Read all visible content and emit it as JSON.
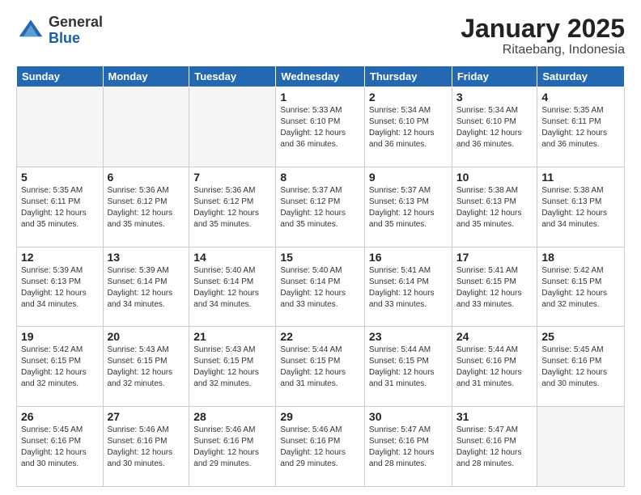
{
  "logo": {
    "general": "General",
    "blue": "Blue"
  },
  "header": {
    "month": "January 2025",
    "location": "Ritaebang, Indonesia"
  },
  "weekdays": [
    "Sunday",
    "Monday",
    "Tuesday",
    "Wednesday",
    "Thursday",
    "Friday",
    "Saturday"
  ],
  "rows": [
    [
      {
        "day": "",
        "sunrise": "",
        "sunset": "",
        "daylight": "",
        "empty": true
      },
      {
        "day": "",
        "sunrise": "",
        "sunset": "",
        "daylight": "",
        "empty": true
      },
      {
        "day": "",
        "sunrise": "",
        "sunset": "",
        "daylight": "",
        "empty": true
      },
      {
        "day": "1",
        "sunrise": "Sunrise: 5:33 AM",
        "sunset": "Sunset: 6:10 PM",
        "daylight": "Daylight: 12 hours and 36 minutes."
      },
      {
        "day": "2",
        "sunrise": "Sunrise: 5:34 AM",
        "sunset": "Sunset: 6:10 PM",
        "daylight": "Daylight: 12 hours and 36 minutes."
      },
      {
        "day": "3",
        "sunrise": "Sunrise: 5:34 AM",
        "sunset": "Sunset: 6:10 PM",
        "daylight": "Daylight: 12 hours and 36 minutes."
      },
      {
        "day": "4",
        "sunrise": "Sunrise: 5:35 AM",
        "sunset": "Sunset: 6:11 PM",
        "daylight": "Daylight: 12 hours and 36 minutes."
      }
    ],
    [
      {
        "day": "5",
        "sunrise": "Sunrise: 5:35 AM",
        "sunset": "Sunset: 6:11 PM",
        "daylight": "Daylight: 12 hours and 35 minutes."
      },
      {
        "day": "6",
        "sunrise": "Sunrise: 5:36 AM",
        "sunset": "Sunset: 6:12 PM",
        "daylight": "Daylight: 12 hours and 35 minutes."
      },
      {
        "day": "7",
        "sunrise": "Sunrise: 5:36 AM",
        "sunset": "Sunset: 6:12 PM",
        "daylight": "Daylight: 12 hours and 35 minutes."
      },
      {
        "day": "8",
        "sunrise": "Sunrise: 5:37 AM",
        "sunset": "Sunset: 6:12 PM",
        "daylight": "Daylight: 12 hours and 35 minutes."
      },
      {
        "day": "9",
        "sunrise": "Sunrise: 5:37 AM",
        "sunset": "Sunset: 6:13 PM",
        "daylight": "Daylight: 12 hours and 35 minutes."
      },
      {
        "day": "10",
        "sunrise": "Sunrise: 5:38 AM",
        "sunset": "Sunset: 6:13 PM",
        "daylight": "Daylight: 12 hours and 35 minutes."
      },
      {
        "day": "11",
        "sunrise": "Sunrise: 5:38 AM",
        "sunset": "Sunset: 6:13 PM",
        "daylight": "Daylight: 12 hours and 34 minutes."
      }
    ],
    [
      {
        "day": "12",
        "sunrise": "Sunrise: 5:39 AM",
        "sunset": "Sunset: 6:13 PM",
        "daylight": "Daylight: 12 hours and 34 minutes."
      },
      {
        "day": "13",
        "sunrise": "Sunrise: 5:39 AM",
        "sunset": "Sunset: 6:14 PM",
        "daylight": "Daylight: 12 hours and 34 minutes."
      },
      {
        "day": "14",
        "sunrise": "Sunrise: 5:40 AM",
        "sunset": "Sunset: 6:14 PM",
        "daylight": "Daylight: 12 hours and 34 minutes."
      },
      {
        "day": "15",
        "sunrise": "Sunrise: 5:40 AM",
        "sunset": "Sunset: 6:14 PM",
        "daylight": "Daylight: 12 hours and 33 minutes."
      },
      {
        "day": "16",
        "sunrise": "Sunrise: 5:41 AM",
        "sunset": "Sunset: 6:14 PM",
        "daylight": "Daylight: 12 hours and 33 minutes."
      },
      {
        "day": "17",
        "sunrise": "Sunrise: 5:41 AM",
        "sunset": "Sunset: 6:15 PM",
        "daylight": "Daylight: 12 hours and 33 minutes."
      },
      {
        "day": "18",
        "sunrise": "Sunrise: 5:42 AM",
        "sunset": "Sunset: 6:15 PM",
        "daylight": "Daylight: 12 hours and 32 minutes."
      }
    ],
    [
      {
        "day": "19",
        "sunrise": "Sunrise: 5:42 AM",
        "sunset": "Sunset: 6:15 PM",
        "daylight": "Daylight: 12 hours and 32 minutes."
      },
      {
        "day": "20",
        "sunrise": "Sunrise: 5:43 AM",
        "sunset": "Sunset: 6:15 PM",
        "daylight": "Daylight: 12 hours and 32 minutes."
      },
      {
        "day": "21",
        "sunrise": "Sunrise: 5:43 AM",
        "sunset": "Sunset: 6:15 PM",
        "daylight": "Daylight: 12 hours and 32 minutes."
      },
      {
        "day": "22",
        "sunrise": "Sunrise: 5:44 AM",
        "sunset": "Sunset: 6:15 PM",
        "daylight": "Daylight: 12 hours and 31 minutes."
      },
      {
        "day": "23",
        "sunrise": "Sunrise: 5:44 AM",
        "sunset": "Sunset: 6:15 PM",
        "daylight": "Daylight: 12 hours and 31 minutes."
      },
      {
        "day": "24",
        "sunrise": "Sunrise: 5:44 AM",
        "sunset": "Sunset: 6:16 PM",
        "daylight": "Daylight: 12 hours and 31 minutes."
      },
      {
        "day": "25",
        "sunrise": "Sunrise: 5:45 AM",
        "sunset": "Sunset: 6:16 PM",
        "daylight": "Daylight: 12 hours and 30 minutes."
      }
    ],
    [
      {
        "day": "26",
        "sunrise": "Sunrise: 5:45 AM",
        "sunset": "Sunset: 6:16 PM",
        "daylight": "Daylight: 12 hours and 30 minutes."
      },
      {
        "day": "27",
        "sunrise": "Sunrise: 5:46 AM",
        "sunset": "Sunset: 6:16 PM",
        "daylight": "Daylight: 12 hours and 30 minutes."
      },
      {
        "day": "28",
        "sunrise": "Sunrise: 5:46 AM",
        "sunset": "Sunset: 6:16 PM",
        "daylight": "Daylight: 12 hours and 29 minutes."
      },
      {
        "day": "29",
        "sunrise": "Sunrise: 5:46 AM",
        "sunset": "Sunset: 6:16 PM",
        "daylight": "Daylight: 12 hours and 29 minutes."
      },
      {
        "day": "30",
        "sunrise": "Sunrise: 5:47 AM",
        "sunset": "Sunset: 6:16 PM",
        "daylight": "Daylight: 12 hours and 28 minutes."
      },
      {
        "day": "31",
        "sunrise": "Sunrise: 5:47 AM",
        "sunset": "Sunset: 6:16 PM",
        "daylight": "Daylight: 12 hours and 28 minutes."
      },
      {
        "day": "",
        "sunrise": "",
        "sunset": "",
        "daylight": "",
        "empty": true
      }
    ]
  ]
}
